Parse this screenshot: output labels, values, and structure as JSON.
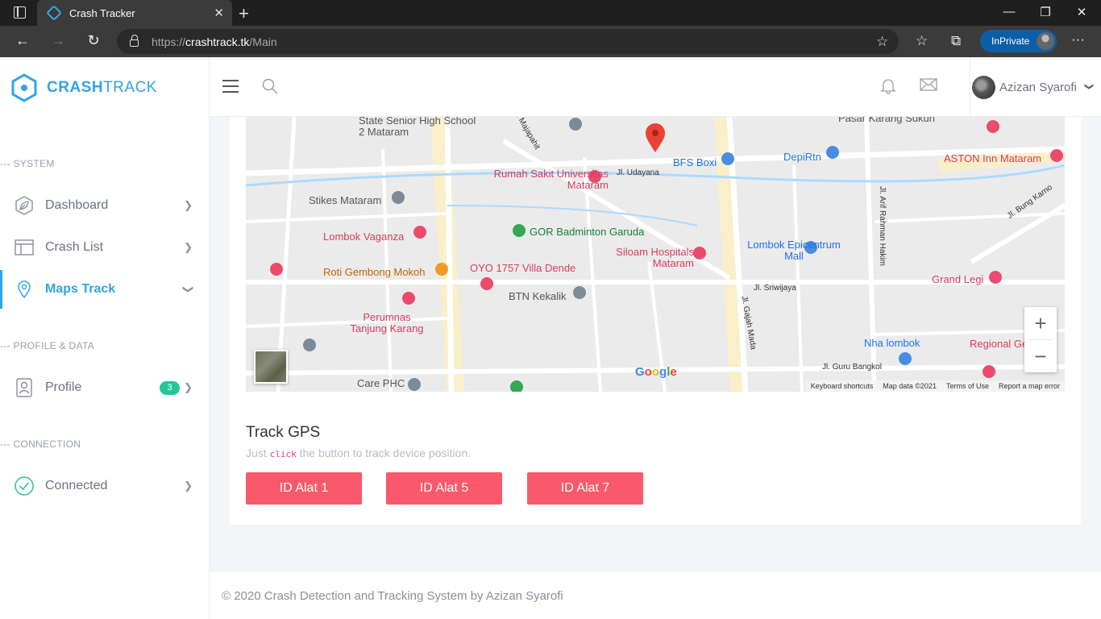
{
  "browser": {
    "tab_title": "Crash Tracker",
    "url_prefix": "https://",
    "url_domain": "crashtrack.tk",
    "url_path": "/Main",
    "inprivate_label": "InPrivate"
  },
  "brand": {
    "bold": "CRASH",
    "rest": "TRACK"
  },
  "sidebar": {
    "sections": [
      {
        "label": "--- SYSTEM"
      },
      {
        "label": "--- PROFILE & DATA"
      },
      {
        "label": "--- CONNECTION"
      }
    ],
    "items": [
      {
        "label": "Dashboard",
        "icon": "leaf-icon"
      },
      {
        "label": "Crash List",
        "icon": "table-icon"
      },
      {
        "label": "Maps Track",
        "icon": "map-pin-icon",
        "active": true
      },
      {
        "label": "Profile",
        "icon": "user-icon",
        "badge": "3"
      },
      {
        "label": "Connected",
        "icon": "check-circle-icon"
      }
    ]
  },
  "topbar": {
    "user_name": "Azizan Syarofi"
  },
  "map": {
    "labels": [
      "State Senior High School 2 Mataram",
      "BFS Boxi",
      "DepiRtn",
      "Pasar Karang Sukun",
      "ASTON Inn Mataram",
      "Rumah Sakit Universitas Mataram",
      "Stikes Mataram",
      "GOR Badminton Garuda",
      "Lombok Vaganza",
      "Siloam Hospitals Mataram",
      "Lombok Epicentrum Mall",
      "Roti Gembong Mokoh",
      "OYO 1757 Villa Dende",
      "BTN Kekalik",
      "Perumnas Tanjung Karang",
      "Grand Legi",
      "Nha lombok",
      "Regional General Hospital",
      "Care PHC",
      "Jl. Sriwijaya",
      "Jl. Gajah Mada",
      "Jl. Arif Rahman Hakim",
      "Jl. Guru Bangkol",
      "Jl. Bung Karno",
      "Jl. Majapahit",
      "Jl. Udayana"
    ],
    "attribution": [
      "Keyboard shortcuts",
      "Map data ©2021",
      "Terms of Use",
      "Report a map error"
    ],
    "google": "Google"
  },
  "track": {
    "title": "Track GPS",
    "sub_before": "Just ",
    "sub_code": "click",
    "sub_after": " the button to track device position.",
    "buttons": [
      "ID Alat 1",
      "ID Alat 5",
      "ID Alat 7"
    ]
  },
  "footer": {
    "text": "© 2020 Crash Detection and Tracking System by Azizan Syarofi"
  },
  "colors": {
    "accent": "#2fa4e7",
    "button": "#f9596a",
    "badge": "#20c997"
  }
}
